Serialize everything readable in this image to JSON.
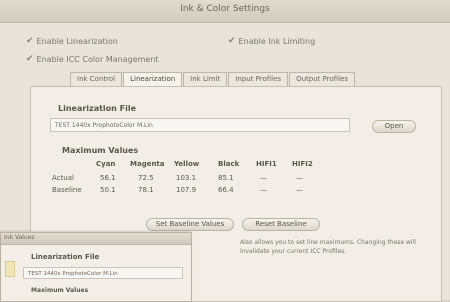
{
  "window": {
    "title": "Ink & Color Settings"
  },
  "options": {
    "linearization_label": "Enable Linearization",
    "ink_limiting_label": "Enable Ink Limiting",
    "icc_label": "Enable ICC Color Management"
  },
  "tabs": [
    {
      "label": "Ink Control"
    },
    {
      "label": "Linearization"
    },
    {
      "label": "Ink Limit"
    },
    {
      "label": "Input Profiles"
    },
    {
      "label": "Output Profiles"
    }
  ],
  "linearization": {
    "section_title": "Linearization File",
    "file_value": "TEST 1440x ProphotoColor M.Lin",
    "open_button": "Open"
  },
  "max_values": {
    "section_title": "Maximum Values",
    "columns": [
      "Cyan",
      "Magenta",
      "Yellow",
      "Black",
      "HIFI1",
      "HIFI2"
    ],
    "rows": [
      {
        "label": "Actual",
        "values": [
          "56.1",
          "72.5",
          "103.1",
          "85.1",
          "—",
          "—"
        ]
      },
      {
        "label": "Baseline",
        "values": [
          "50.1",
          "78.1",
          "107.9",
          "66.4",
          "—",
          "—"
        ]
      }
    ],
    "set_baseline_button": "Set Baseline Values",
    "reset_baseline_button": "Reset Baseline"
  },
  "info_text": "Also allows you to set line maximums. Changing these will invalidate your current ICC Profiles.",
  "overlay": {
    "title": "Ink Values",
    "section_title": "Linearization File",
    "file_value": "TEST 1440x ProphotoColor M.Lin",
    "sub_title": "Maximum Values"
  }
}
